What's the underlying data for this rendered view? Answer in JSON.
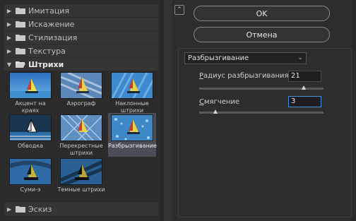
{
  "gallery": {
    "categories_top": [
      {
        "label": "Имитация"
      },
      {
        "label": "Искажение"
      },
      {
        "label": "Стилизация"
      },
      {
        "label": "Текстура"
      }
    ],
    "open_category": {
      "label": "Штрихи"
    },
    "thumbnails": [
      {
        "caption": "Акцент на краях"
      },
      {
        "caption": "Аэрограф"
      },
      {
        "caption": "Наклонные штрихи"
      },
      {
        "caption": "Обводка"
      },
      {
        "caption": "Перекрестные штрихи"
      },
      {
        "caption": "Разбрызгивание"
      },
      {
        "caption": "Суми-э"
      },
      {
        "caption": "Темные штрихи"
      }
    ],
    "categories_bottom": [
      {
        "label": "Эскиз"
      }
    ],
    "selected_thumbnail": "Разбрызгивание"
  },
  "buttons": {
    "ok_label": "OK",
    "cancel_label": "Отмена"
  },
  "settings": {
    "filter_select": "Разбрызгивание",
    "spray_radius": {
      "label_prefix": "Р",
      "label_rest": "адиус разбрызгивания",
      "value": "21",
      "level": 0.84
    },
    "smoothness": {
      "label_prefix": "С",
      "label_rest": "мягчение",
      "value": "3",
      "level": 0.13
    }
  },
  "colors": {
    "selection": "#4a4f57",
    "active_field": "#4a8ee0"
  }
}
